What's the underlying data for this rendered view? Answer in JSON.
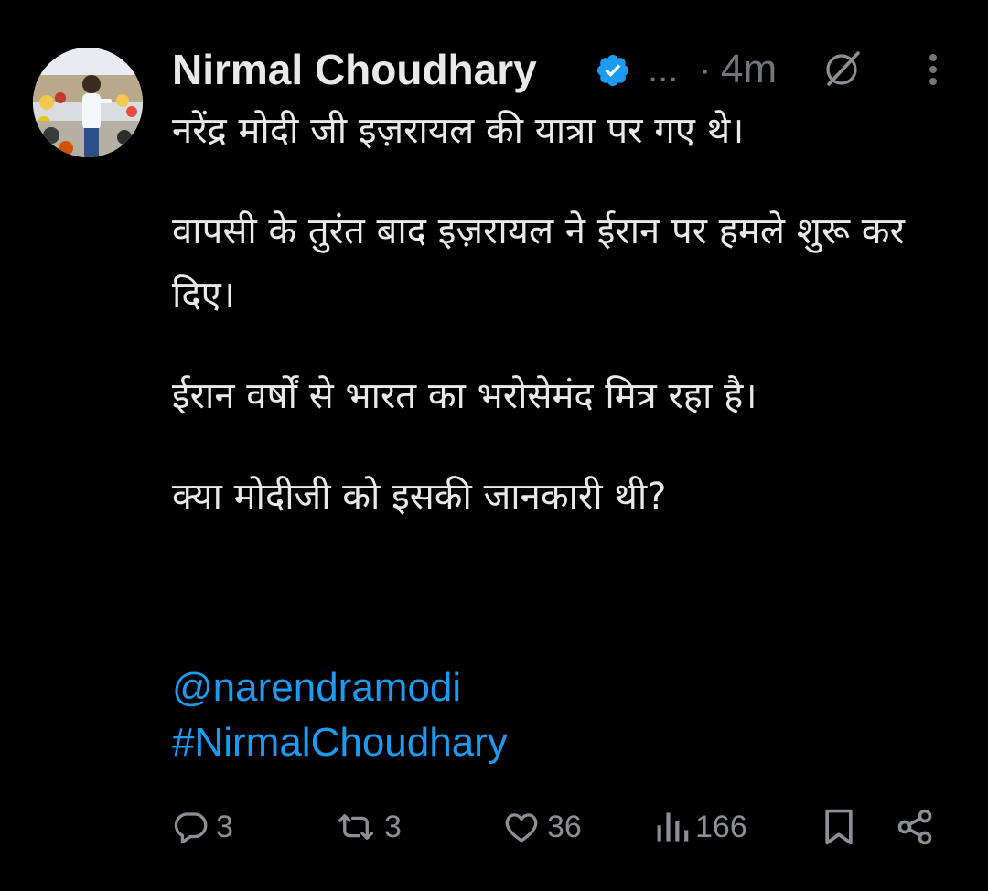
{
  "tweet": {
    "author_name": "Nirmal Choudhary",
    "ellipsis": "...",
    "separator": "·",
    "timestamp": "4m",
    "paragraphs": [
      "नरेंद्र मोदी जी इज़रायल की यात्रा पर गए थे।",
      "वापसी के तुरंत बाद इज़रायल ने ईरान पर हमले शुरू कर दिए।",
      "ईरान वर्षों से भारत का भरोसेमंद मित्र रहा है।",
      "क्या मोदीजी को इसकी जानकारी थी?"
    ],
    "mention": "@narendramodi",
    "hashtag": "#NirmalChoudhary"
  },
  "actions": {
    "replies": "3",
    "reposts": "3",
    "likes": "36",
    "views": "166"
  },
  "icons": {
    "verified": "verified-badge-icon",
    "grok": "grok-icon",
    "more": "more-vertical-icon",
    "reply": "reply-icon",
    "repost": "repost-icon",
    "like": "heart-icon",
    "views": "views-chart-icon",
    "bookmark": "bookmark-icon",
    "share": "share-icon"
  },
  "colors": {
    "background": "#000000",
    "text_primary": "#e7e9ea",
    "text_secondary": "#71767b",
    "link": "#1d9bf0",
    "verified": "#1d9bf0"
  }
}
